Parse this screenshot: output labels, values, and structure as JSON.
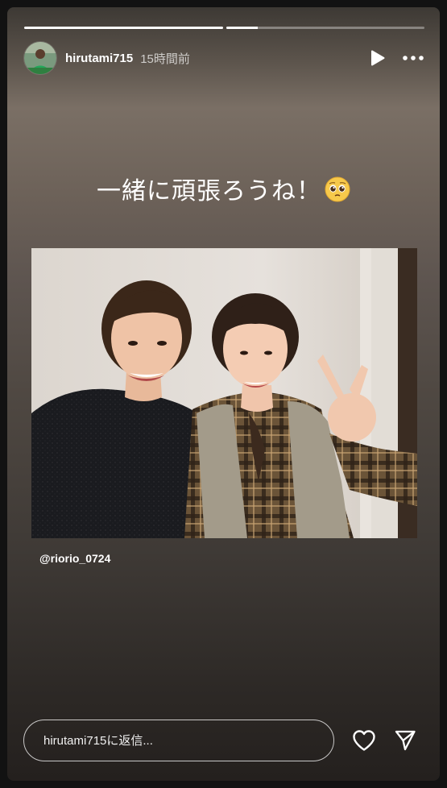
{
  "story": {
    "progress": [
      1.0,
      0.16
    ],
    "user": {
      "name": "hirutami715",
      "time": "15時間前"
    },
    "caption": "一緒に頑張ろうね！",
    "caption_emoji": "pleading-face-emoji",
    "mention": "@riorio_0724",
    "reply_placeholder": "hirutami715に返信...",
    "icons": [
      "play-icon",
      "more-icon",
      "heart-icon",
      "send-icon"
    ]
  }
}
